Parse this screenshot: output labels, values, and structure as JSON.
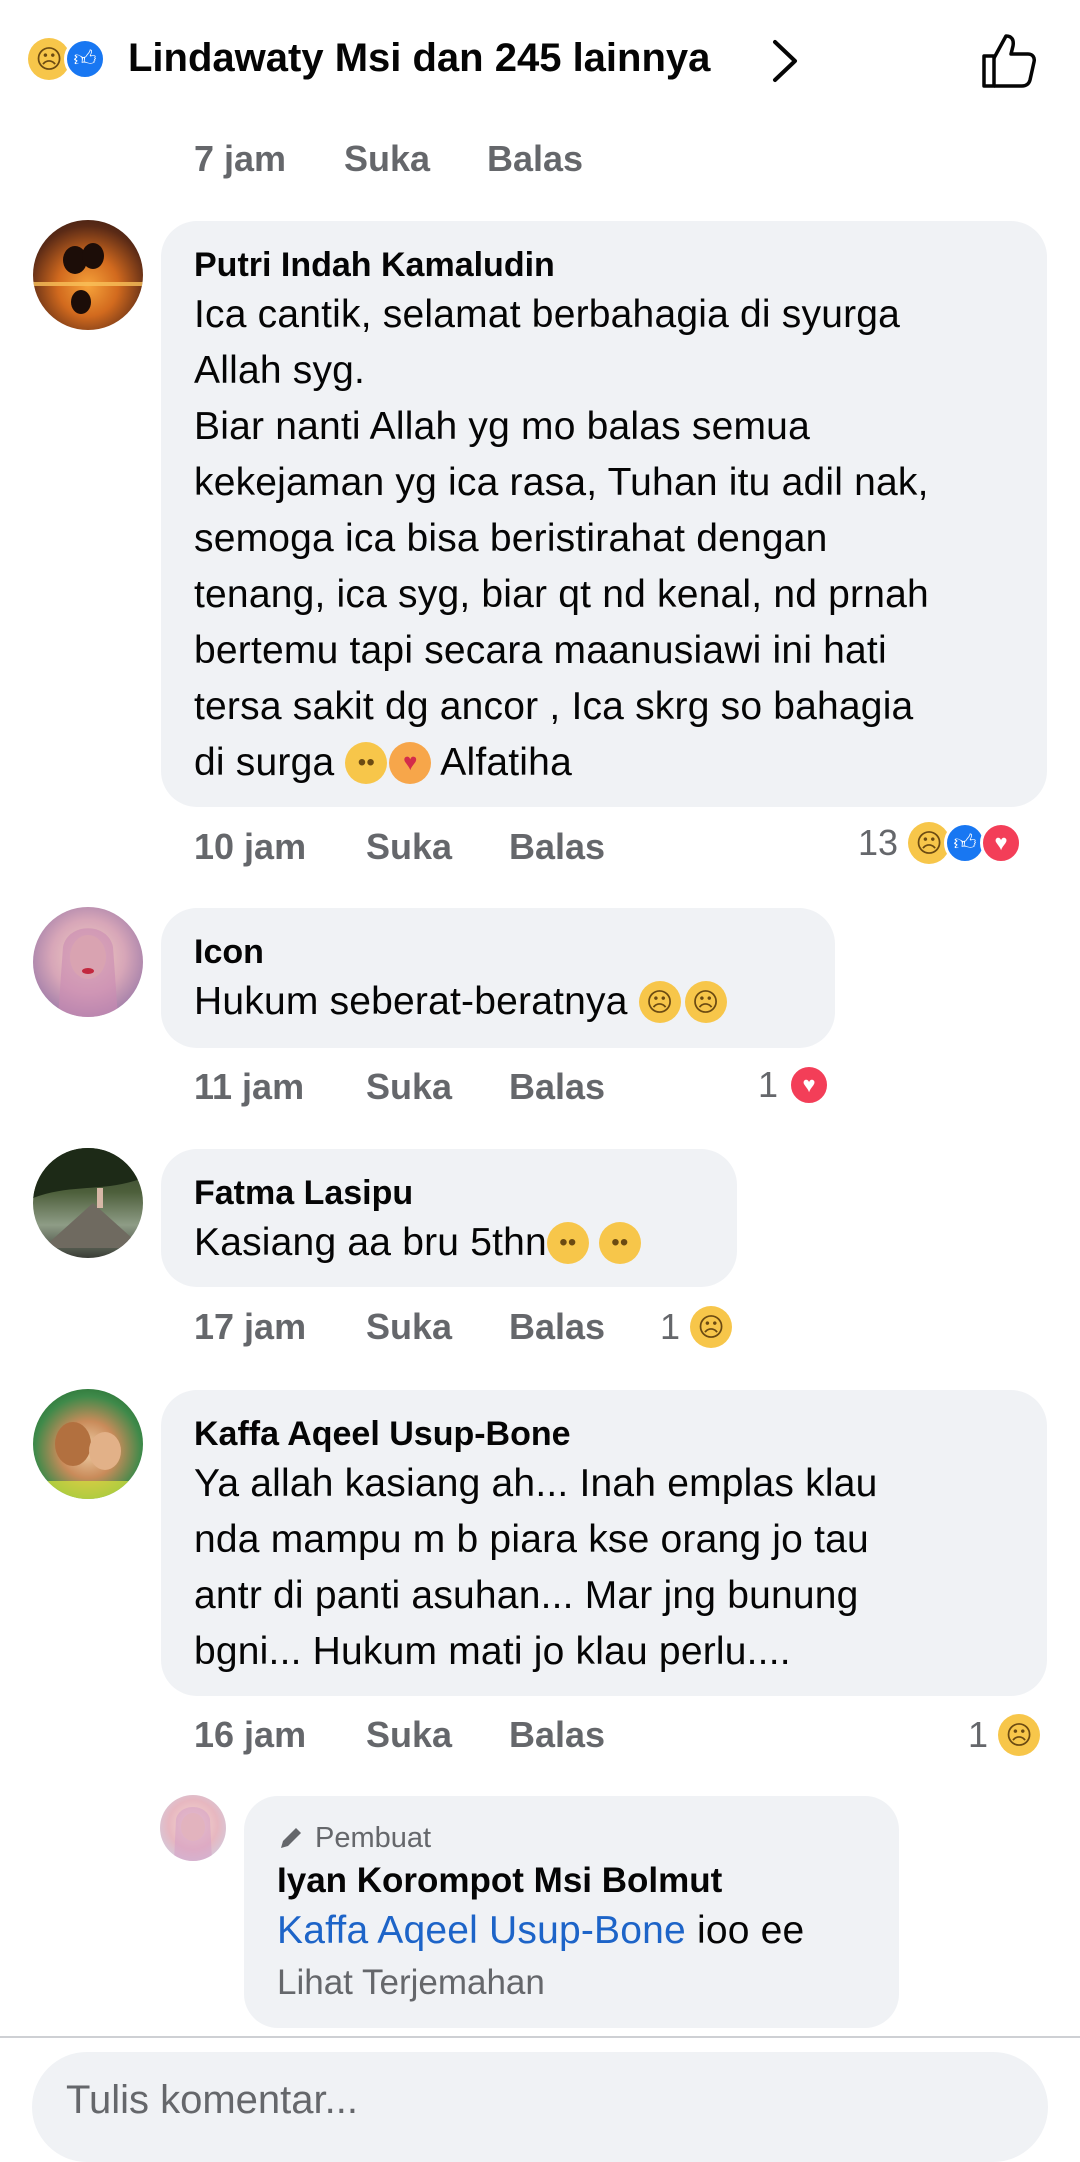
{
  "header": {
    "reaction_icons": [
      "sad-emoji-icon",
      "like-icon"
    ],
    "text": "Lindawaty Msi dan 245 lainnya"
  },
  "prev_meta": {
    "time": "7 jam",
    "like": "Suka",
    "reply": "Balas"
  },
  "comments": [
    {
      "author": "Putri Indah Kamaludin",
      "lines": [
        "Ica cantik, selamat berbahagia di syurga",
        "Allah syg.",
        "Biar nanti Allah yg mo balas semua",
        "kekejaman yg ica rasa, Tuhan itu adil nak,",
        "semoga ica bisa beristirahat dengan",
        "tenang, ica syg, biar qt nd kenal, nd prnah",
        "bertemu tapi secara maanusiawi ini hati",
        "tersa sakit dg ancor , Ica skrg so bahagia"
      ],
      "last_line_start": "di surga ",
      "last_line_end": " Alfatiha",
      "time": "10 jam",
      "like": "Suka",
      "reply": "Balas",
      "reaction_count": "13",
      "reactions": [
        "sad",
        "like",
        "love"
      ]
    },
    {
      "author": "Icon",
      "text": "Hukum seberat-beratnya ",
      "time": "11 jam",
      "like": "Suka",
      "reply": "Balas",
      "reaction_count": "1",
      "reactions": [
        "love"
      ]
    },
    {
      "author": "Fatma Lasipu",
      "text": "Kasiang aa bru 5thn",
      "time": "17 jam",
      "like": "Suka",
      "reply": "Balas",
      "reaction_count": "1",
      "reactions": [
        "sad"
      ]
    },
    {
      "author": "Kaffa Aqeel Usup-Bone",
      "lines": [
        "Ya allah kasiang ah... Inah emplas klau",
        "nda mampu m b piara kse orang jo tau",
        "antr di panti asuhan... Mar jng bunung",
        "bgni... Hukum mati jo klau perlu...."
      ],
      "time": "16 jam",
      "like": "Suka",
      "reply": "Balas",
      "reaction_count": "1",
      "reactions": [
        "sad"
      ]
    }
  ],
  "reply": {
    "badge": "Pembuat",
    "author": "Iyan Korompot Msi Bolmut",
    "mention": "Kaffa Aqeel Usup-Bone",
    "text": " ioo ee",
    "translate": "Lihat Terjemahan"
  },
  "composer": {
    "placeholder": "Tulis komentar..."
  },
  "colors": {
    "bubble": "#f0f2f5",
    "meta_gray": "#65676b",
    "like_blue": "#1877f2",
    "love_red": "#f33e58",
    "sad_yellow": "#f7c64a",
    "mention_blue": "#1d64c8"
  }
}
